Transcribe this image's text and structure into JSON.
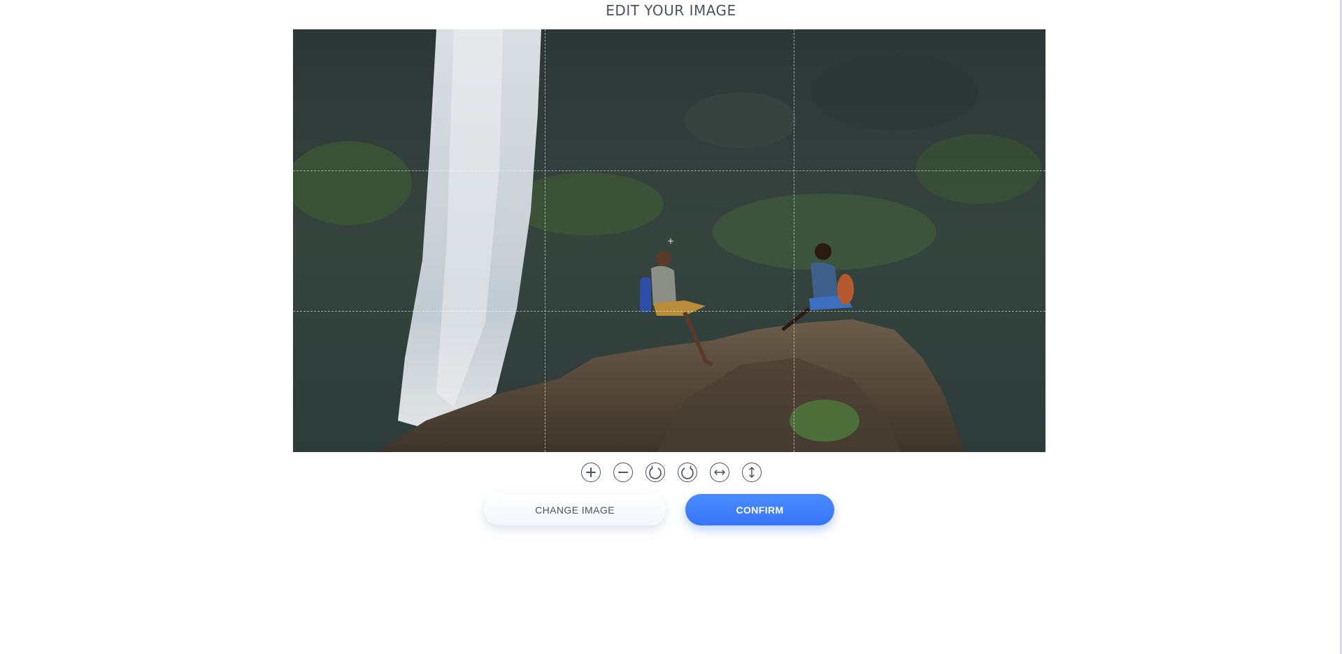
{
  "header": {
    "title": "EDIT YOUR IMAGE"
  },
  "editor": {
    "image_description_icon": "photo-waterfall-couple",
    "crop_crosshair": "+",
    "tools": [
      {
        "name": "zoom-in-icon",
        "label": "Zoom in"
      },
      {
        "name": "zoom-out-icon",
        "label": "Zoom out"
      },
      {
        "name": "rotate-left-icon",
        "label": "Rotate left"
      },
      {
        "name": "rotate-right-icon",
        "label": "Rotate right"
      },
      {
        "name": "flip-horizontal-icon",
        "label": "Flip horizontal"
      },
      {
        "name": "flip-vertical-icon",
        "label": "Flip vertical"
      }
    ]
  },
  "actions": {
    "change_image_label": "CHANGE IMAGE",
    "confirm_label": "CONFIRM"
  },
  "colors": {
    "accent": "#3875f6",
    "text": "#4a5261"
  }
}
